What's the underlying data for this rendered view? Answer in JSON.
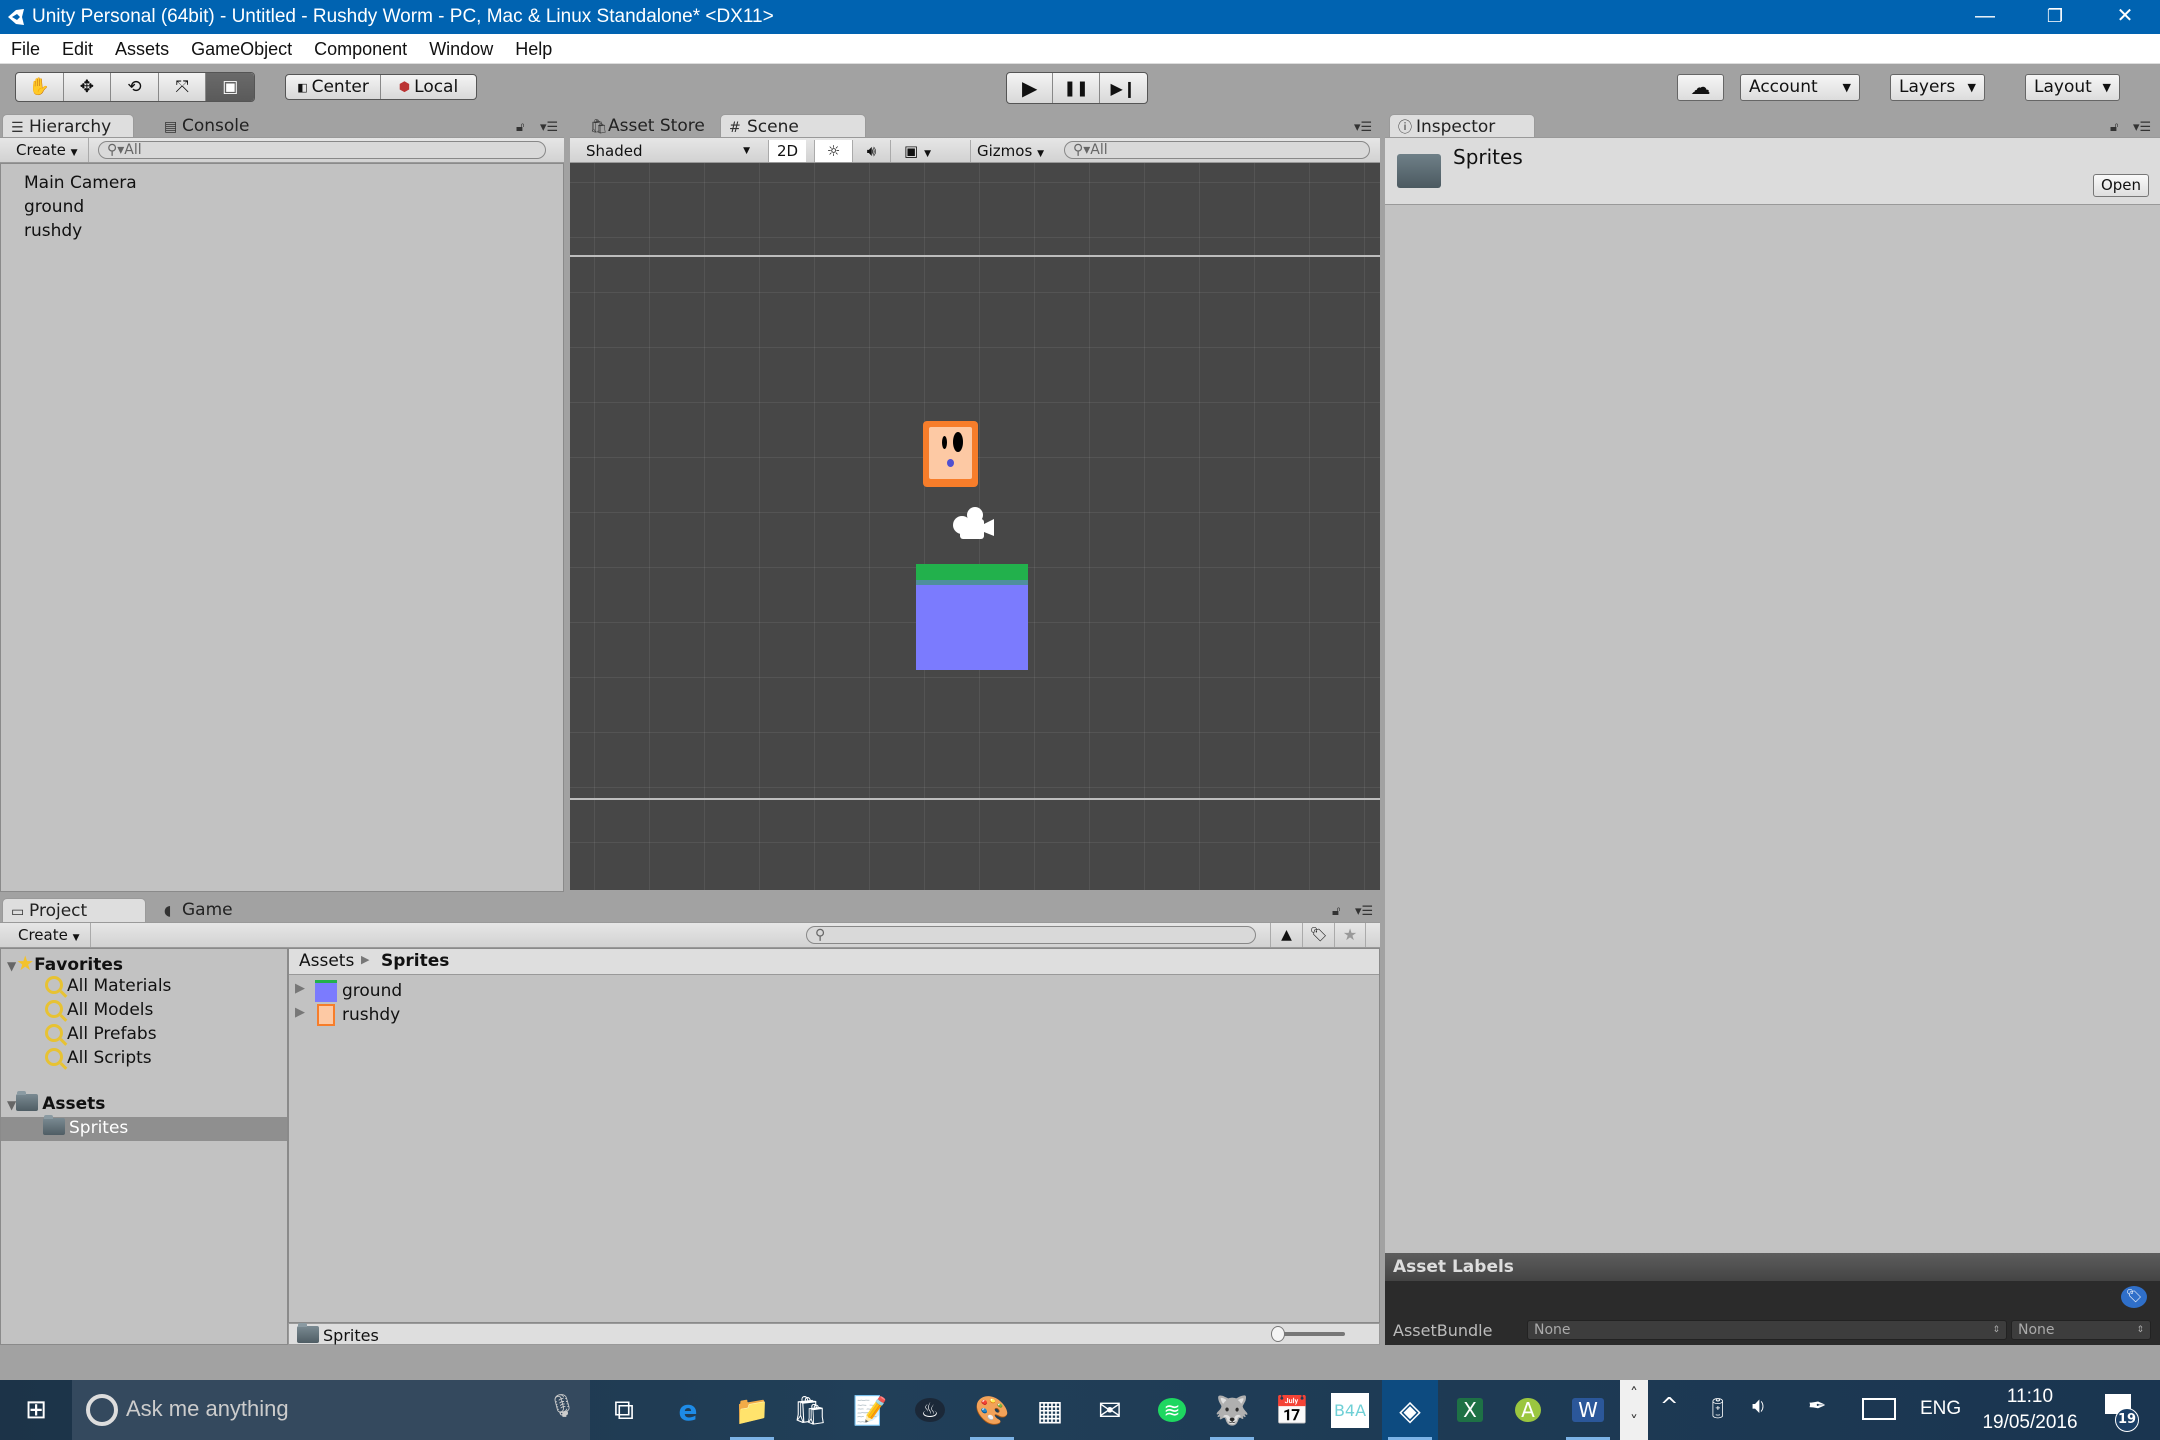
{
  "window": {
    "title": "Unity Personal (64bit) - Untitled - Rushdy Worm - PC, Mac & Linux Standalone* <DX11>",
    "controls": {
      "minimize": "—",
      "restore": "❐",
      "close": "✕"
    }
  },
  "menu": [
    "File",
    "Edit",
    "Assets",
    "GameObject",
    "Component",
    "Window",
    "Help"
  ],
  "toolbar": {
    "tools": [
      {
        "name": "hand-tool",
        "glyph": "✋",
        "active": false
      },
      {
        "name": "move-tool",
        "glyph": "✥",
        "active": false
      },
      {
        "name": "rotate-tool",
        "glyph": "⟲",
        "active": false
      },
      {
        "name": "scale-tool",
        "glyph": "⤧",
        "active": false
      },
      {
        "name": "rect-tool",
        "glyph": "▣",
        "active": true
      }
    ],
    "pivot": {
      "center": "Center",
      "local": "Local"
    },
    "play": {
      "play": "▶",
      "pause": "❚❚",
      "step": "▶❙"
    },
    "cloud_glyph": "☁",
    "account": "Account",
    "layers": "Layers",
    "layout": "Layout"
  },
  "hierarchy": {
    "tabs": [
      "Hierarchy",
      "Console"
    ],
    "create": "Create",
    "search_placeholder": "All",
    "items": [
      "Main Camera",
      "ground",
      "rushdy"
    ]
  },
  "scene": {
    "tabs": [
      "Asset Store",
      "Scene"
    ],
    "shading": "Shaded",
    "mode_2d": "2D",
    "gizmos": "Gizmos",
    "search_placeholder": "All",
    "colors": {
      "background": "#474747",
      "rushdy_border": "#f77d2a",
      "rushdy_face": "#fdc9a4",
      "ground_top": "#22b14c",
      "ground_body": "#7b7bfe"
    }
  },
  "inspector": {
    "tab": "Inspector",
    "asset_name": "Sprites",
    "open_button": "Open",
    "asset_labels_title": "Asset Labels",
    "assetbundle_label": "AssetBundle",
    "assetbundle_value": "None",
    "assetbundle_variant": "None"
  },
  "project": {
    "tabs": [
      "Project",
      "Game"
    ],
    "create": "Create",
    "favorites_label": "Favorites",
    "favorites": [
      "All Materials",
      "All Models",
      "All Prefabs",
      "All Scripts"
    ],
    "assets_label": "Assets",
    "folders": [
      "Sprites"
    ],
    "selected_folder": "Sprites",
    "breadcrumb": [
      "Assets",
      "Sprites"
    ],
    "files": [
      "ground",
      "rushdy"
    ],
    "footer_path": "Sprites",
    "icon_size_slider": 0.0
  },
  "taskbar": {
    "search_placeholder": "Ask me anything",
    "apps": [
      {
        "name": "task-view",
        "glyph": "⧉",
        "running": false
      },
      {
        "name": "edge",
        "glyph": "e",
        "running": false
      },
      {
        "name": "file-explorer",
        "glyph": "📁",
        "running": true
      },
      {
        "name": "store",
        "glyph": "🛍",
        "running": false
      },
      {
        "name": "notepad",
        "glyph": "📝",
        "running": false
      },
      {
        "name": "steam",
        "glyph": "♨",
        "running": false
      },
      {
        "name": "paint",
        "glyph": "🎨",
        "running": true
      },
      {
        "name": "calculator",
        "glyph": "▦",
        "running": false
      },
      {
        "name": "mail",
        "glyph": "✉",
        "running": false
      },
      {
        "name": "spotify",
        "glyph": "≋",
        "running": false
      },
      {
        "name": "gimp",
        "glyph": "🐺",
        "running": true
      },
      {
        "name": "calendar",
        "glyph": "📅",
        "running": false
      },
      {
        "name": "b4a",
        "glyph": "B4A",
        "running": false
      },
      {
        "name": "unity",
        "glyph": "◈",
        "running": true
      },
      {
        "name": "excel",
        "glyph": "X",
        "running": false
      },
      {
        "name": "android-studio",
        "glyph": "A",
        "running": false
      },
      {
        "name": "word",
        "glyph": "W",
        "running": true
      }
    ],
    "language": "ENG",
    "time": "11:10",
    "date": "19/05/2016",
    "notifications": "19"
  }
}
